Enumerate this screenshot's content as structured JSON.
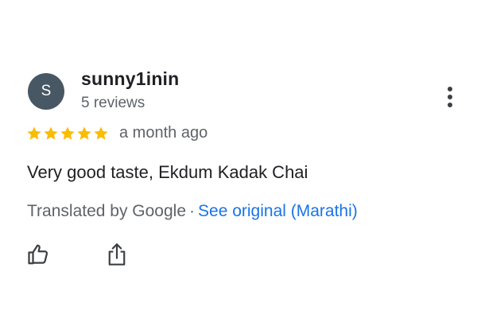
{
  "review": {
    "avatar_initial": "S",
    "author_name": "sunny1inin",
    "author_reviews": "5 reviews",
    "rating": 5,
    "rating_max": 5,
    "time_ago": "a month ago",
    "text": "Very good taste, Ekdum Kadak Chai",
    "translated_by": "Translated by Google",
    "separator": "·",
    "see_original": "See original (Marathi)"
  },
  "colors": {
    "avatar_bg": "#475763",
    "star": "#fbbc04",
    "link": "#1a73e8",
    "secondary_text": "#5f6368",
    "primary_text": "#202124"
  },
  "icons": {
    "more": "more-vertical-icon",
    "like": "thumbs-up-icon",
    "share": "share-icon",
    "star": "star-icon"
  }
}
